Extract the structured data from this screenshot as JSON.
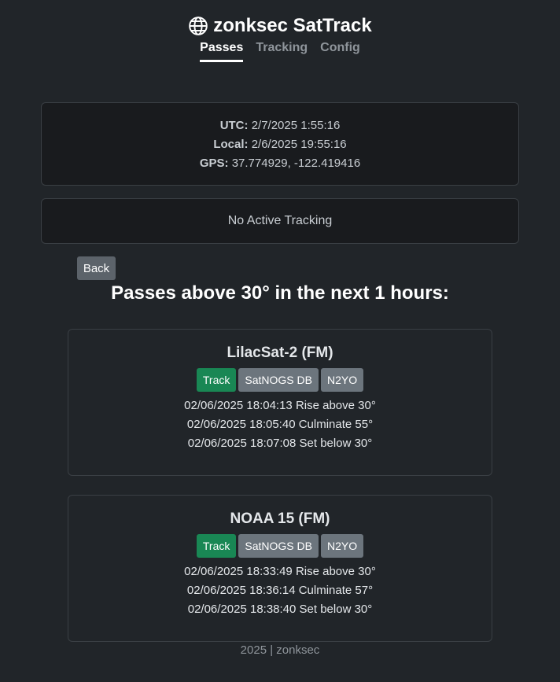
{
  "app": {
    "title": "zonksec SatTrack",
    "icon": "globe-icon"
  },
  "nav": {
    "tabs": [
      {
        "label": "Passes",
        "active": true
      },
      {
        "label": "Tracking",
        "active": false
      },
      {
        "label": "Config",
        "active": false
      }
    ]
  },
  "info": {
    "utc_label": "UTC:",
    "utc_value": "2/7/2025 1:55:16",
    "local_label": "Local:",
    "local_value": "2/6/2025 19:55:16",
    "gps_label": "GPS:",
    "gps_value": "37.774929, -122.419416"
  },
  "tracking": {
    "status": "No Active Tracking"
  },
  "back_label": "Back",
  "passes_title": "Passes above 30° in the next 1 hours:",
  "passes": [
    {
      "name": "LilacSat-2 (FM)",
      "buttons": {
        "track": "Track",
        "satnogs": "SatNOGS DB",
        "n2yo": "N2YO"
      },
      "rise": "02/06/2025 18:04:13 Rise above 30°",
      "culminate": "02/06/2025 18:05:40 Culminate 55°",
      "set": "02/06/2025 18:07:08 Set below 30°"
    },
    {
      "name": "NOAA 15 (FM)",
      "buttons": {
        "track": "Track",
        "satnogs": "SatNOGS DB",
        "n2yo": "N2YO"
      },
      "rise": "02/06/2025 18:33:49 Rise above 30°",
      "culminate": "02/06/2025 18:36:14 Culminate 57°",
      "set": "02/06/2025 18:38:40 Set below 30°"
    }
  ],
  "footer": "2025 | zonksec",
  "colors": {
    "background": "#212529",
    "card": "#191b1e",
    "track_button": "#198754",
    "grey_button": "#6c757d"
  }
}
